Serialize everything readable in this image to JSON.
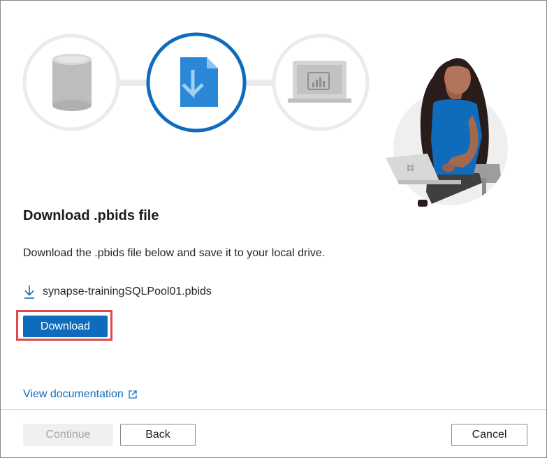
{
  "dialog": {
    "title": "Download .pbids file",
    "description": "Download the .pbids file below and save it to your local drive.",
    "file_name": "synapse-trainingSQLPool01.pbids",
    "download_label": "Download",
    "doc_link_label": "View documentation"
  },
  "footer": {
    "continue_label": "Continue",
    "back_label": "Back",
    "cancel_label": "Cancel"
  },
  "icons": {
    "steps": [
      "database-icon",
      "file-download-icon",
      "laptop-chart-icon"
    ],
    "file": "download-arrow-icon",
    "doc_link": "external-link-icon"
  },
  "colors": {
    "accent": "#0f6cbd",
    "highlight": "#e0474c",
    "disabled_bg": "#f0f0f0",
    "disabled_text": "#a6a6a6"
  }
}
